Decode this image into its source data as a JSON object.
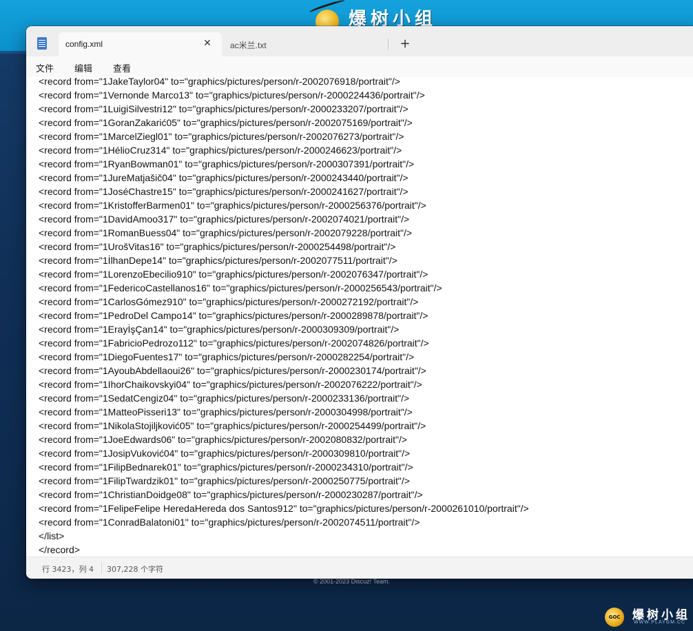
{
  "background": {
    "logo_text": "爆树小组",
    "copyright": "© 2001-2023 Discuz! Team.",
    "watermark_text": "爆树小组",
    "watermark_url": "WWW.PLAYGM.CC",
    "watermark_badge": "GOC"
  },
  "app": {
    "icon": "notepad-icon",
    "tabs": [
      {
        "label": "config.xml",
        "active": true,
        "close": "✕"
      },
      {
        "label": "ac米兰.txt",
        "active": false
      }
    ],
    "new_tab": "+"
  },
  "menu": [
    "文件",
    "编辑",
    "查看"
  ],
  "editor": {
    "lines": [
      "<record from=\"1JakeTaylor04\" to=\"graphics/pictures/person/r-2002076918/portrait\"/>",
      "<record from=\"1Vernonde Marco13\" to=\"graphics/pictures/person/r-2000224436/portrait\"/>",
      "<record from=\"1LuigiSilvestri12\" to=\"graphics/pictures/person/r-2000233207/portrait\"/>",
      "<record from=\"1GoranZakarić05\" to=\"graphics/pictures/person/r-2002075169/portrait\"/>",
      "<record from=\"1MarcelZiegl01\" to=\"graphics/pictures/person/r-2002076273/portrait\"/>",
      "<record from=\"1HélioCruz314\" to=\"graphics/pictures/person/r-2000246623/portrait\"/>",
      "<record from=\"1RyanBowman01\" to=\"graphics/pictures/person/r-2000307391/portrait\"/>",
      "<record from=\"1JureMatjašič04\" to=\"graphics/pictures/person/r-2000243440/portrait\"/>",
      "<record from=\"1JoséChastre15\" to=\"graphics/pictures/person/r-2000241627/portrait\"/>",
      "<record from=\"1KristofferBarmen01\" to=\"graphics/pictures/person/r-2000256376/portrait\"/>",
      "<record from=\"1DavidAmoo317\" to=\"graphics/pictures/person/r-2002074021/portrait\"/>",
      "<record from=\"1RomanBuess04\" to=\"graphics/pictures/person/r-2002079228/portrait\"/>",
      "<record from=\"1UrošVitas16\" to=\"graphics/pictures/person/r-2000254498/portrait\"/>",
      "<record from=\"1İlhanDepe14\" to=\"graphics/pictures/person/r-2002077511/portrait\"/>",
      "<record from=\"1LorenzoEbecilio910\" to=\"graphics/pictures/person/r-2002076347/portrait\"/>",
      "<record from=\"1FedericoCastellanos16\" to=\"graphics/pictures/person/r-2000256543/portrait\"/>",
      "<record from=\"1CarlosGómez910\" to=\"graphics/pictures/person/r-2000272192/portrait\"/>",
      "<record from=\"1PedroDel Campo14\" to=\"graphics/pictures/person/r-2000289878/portrait\"/>",
      "<record from=\"1ErayİşÇan14\" to=\"graphics/pictures/person/r-2000309309/portrait\"/>",
      "<record from=\"1FabricioPedrozo112\" to=\"graphics/pictures/person/r-2002074826/portrait\"/>",
      "<record from=\"1DiegoFuentes17\" to=\"graphics/pictures/person/r-2000282254/portrait\"/>",
      "<record from=\"1AyoubAbdellaoui26\" to=\"graphics/pictures/person/r-2000230174/portrait\"/>",
      "<record from=\"1IhorChaikovskyi04\" to=\"graphics/pictures/person/r-2002076222/portrait\"/>",
      "<record from=\"1SedatCengiz04\" to=\"graphics/pictures/person/r-2000233136/portrait\"/>",
      "<record from=\"1MatteoPisseri13\" to=\"graphics/pictures/person/r-2000304998/portrait\"/>",
      "<record from=\"1NikolaStojiljković05\" to=\"graphics/pictures/person/r-2000254499/portrait\"/>",
      "<record from=\"1JoeEdwards06\" to=\"graphics/pictures/person/r-2002080832/portrait\"/>",
      "<record from=\"1JosipVuković04\" to=\"graphics/pictures/person/r-2000309810/portrait\"/>",
      "<record from=\"1FilipBednarek01\" to=\"graphics/pictures/person/r-2000234310/portrait\"/>",
      "<record from=\"1FilipTwardzik01\" to=\"graphics/pictures/person/r-2000250775/portrait\"/>",
      "<record from=\"1ChristianDoidge08\" to=\"graphics/pictures/person/r-2000230287/portrait\"/>",
      "<record from=\"1FelipeFelipe HeredaHereda dos Santos912\" to=\"graphics/pictures/person/r-2000261010/portrait\"/>",
      "<record from=\"1ConradBalatoni01\" to=\"graphics/pictures/person/r-2002074511/portrait\"/>",
      "</list>",
      "</record>"
    ]
  },
  "status": {
    "position": "行 3423，列 4",
    "char_count": "307,228 个字符"
  }
}
